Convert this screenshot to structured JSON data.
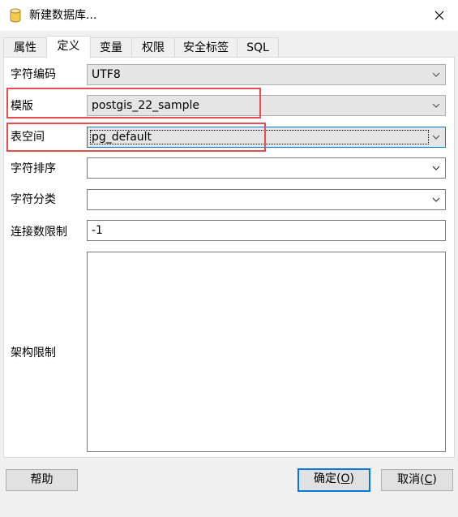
{
  "window": {
    "title": "新建数据库..."
  },
  "tabs": [
    {
      "label": "属性"
    },
    {
      "label": "定义"
    },
    {
      "label": "变量"
    },
    {
      "label": "权限"
    },
    {
      "label": "安全标签"
    },
    {
      "label": "SQL"
    }
  ],
  "active_tab": "定义",
  "form": {
    "encoding": {
      "label": "字符编码",
      "value": "UTF8"
    },
    "template": {
      "label": "模版",
      "value": "postgis_22_sample"
    },
    "tablespace": {
      "label": "表空间",
      "value": "pg_default"
    },
    "collation": {
      "label": "字符排序",
      "value": ""
    },
    "ctype": {
      "label": "字符分类",
      "value": ""
    },
    "connlimit": {
      "label": "连接数限制",
      "value": "-1"
    },
    "schema_restriction": {
      "label": "架构限制",
      "value": ""
    }
  },
  "buttons": {
    "help": "帮助",
    "ok_text": "确定(",
    "ok_key": "O",
    "ok_end": ")",
    "cancel_text": "取消(",
    "cancel_key": "C",
    "cancel_end": ")"
  },
  "colors": {
    "highlight": "#e84c4c",
    "focus": "#0078d7"
  },
  "icons": {
    "title": "database-icon",
    "close": "close-icon",
    "dropdown": "chevron-down-icon"
  }
}
